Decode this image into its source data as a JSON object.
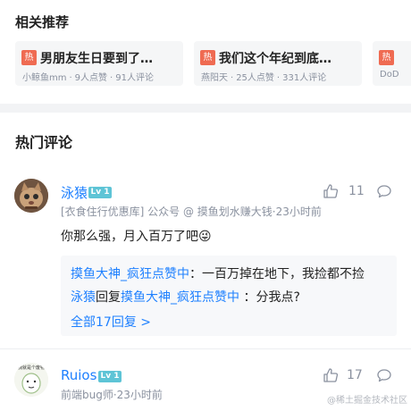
{
  "related": {
    "title": "相关推荐",
    "hot_badge": "热",
    "cards": [
      {
        "title": "男朋友生日要到了…",
        "author": "小鲸鱼mm",
        "likes": "9人点赞",
        "comments": "91人评论"
      },
      {
        "title": "我们这个年纪到底…",
        "author": "燕阳天",
        "likes": "25人点赞",
        "comments": "331人评论"
      },
      {
        "title": "",
        "author": "DoD",
        "likes": "",
        "comments": ""
      }
    ],
    "meta_sep": "·"
  },
  "hot_comments": {
    "title": "热门评论",
    "comments": [
      {
        "username": "泳猿",
        "level": "Lv 1",
        "meta": "[衣食住行优惠库] 公众号 @ 摸鱼划水赚大钱·23小时前",
        "likes": "11",
        "text": "你那么强，月入百万了吧",
        "emoji": "😜",
        "replies": [
          {
            "from": "摸鱼大神_疯狂点赞中",
            "text": "：一百万掉在地下，我捡都不捡"
          },
          {
            "from": "泳猿",
            "action": "回复",
            "to": "摸鱼大神_疯狂点赞中",
            "text": " ：分我点?"
          }
        ],
        "all_replies_label": "全部17回复 >"
      },
      {
        "username": "Ruios",
        "level": "Lv 1",
        "meta": "前端bug师·23小时前",
        "likes": "17",
        "avatar_caption": "我就是个废物"
      }
    ]
  },
  "watermark": "@稀土掘金技术社区",
  "colors": {
    "link": "#1e80ff",
    "hot_badge": "#ef6b52",
    "level_badge": "#5ec4d6",
    "muted": "#8a919f"
  }
}
